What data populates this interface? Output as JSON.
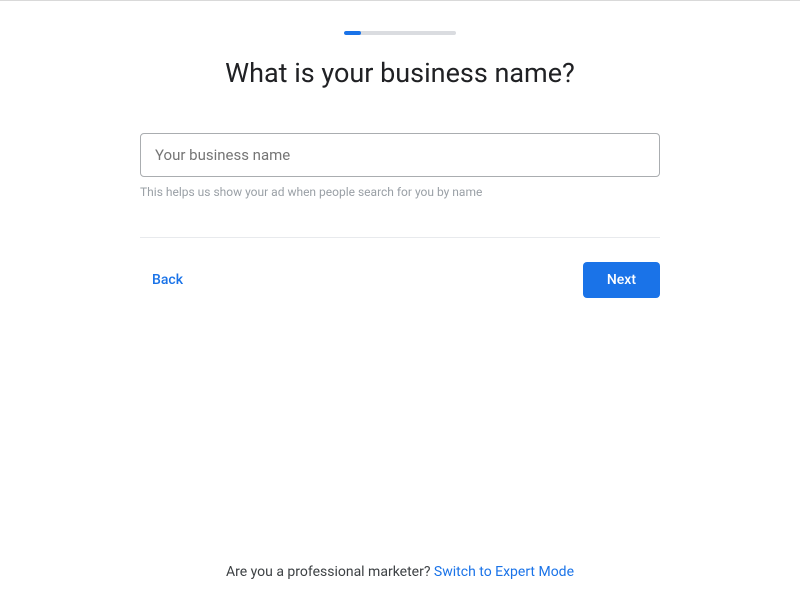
{
  "progress": {
    "percent": 15
  },
  "heading": "What is your business name?",
  "input": {
    "placeholder": "Your business name",
    "value": "",
    "helper": "This helps us show your ad when people search for you by name"
  },
  "nav": {
    "back": "Back",
    "next": "Next"
  },
  "footer": {
    "question": "Are you a professional marketer? ",
    "link": "Switch to Expert Mode"
  }
}
